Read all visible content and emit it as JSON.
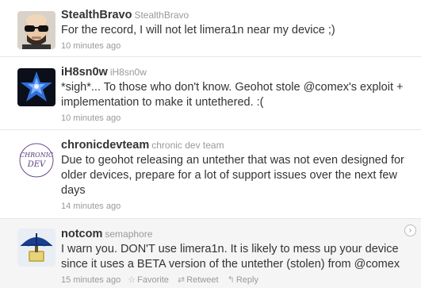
{
  "tweets": [
    {
      "screen_name": "StealthBravo",
      "full_name": "StealthBravo",
      "text": "For the record, I will not let limera1n near my device ;)",
      "time": "10 minutes ago"
    },
    {
      "screen_name": "iH8sn0w",
      "full_name": "iH8sn0w",
      "text": "*sigh*... To those who don't know. Geohot stole @comex's exploit + implementation to make it untethered. :(",
      "time": "10 minutes ago"
    },
    {
      "screen_name": "chronicdevteam",
      "full_name": "chronic dev team",
      "text": "Due to geohot releasing an untether that was not even designed for older devices, prepare for a lot of support issues over the next few days",
      "time": "14 minutes ago",
      "avatar_lines": [
        "CHRONIC",
        "DEV"
      ]
    },
    {
      "screen_name": "notcom",
      "full_name": "semaphore",
      "text": "I warn you. DON'T use limera1n. It is likely to mess up your device since it uses a BETA version of the untether (stolen) from @comex",
      "time": "15 minutes ago",
      "actions": {
        "favorite": "Favorite",
        "retweet": "Retweet",
        "reply": "Reply"
      }
    }
  ],
  "colors": {
    "hover_bg": "#f5f5f5",
    "divider": "#e6e6e6",
    "meta": "#999999"
  }
}
